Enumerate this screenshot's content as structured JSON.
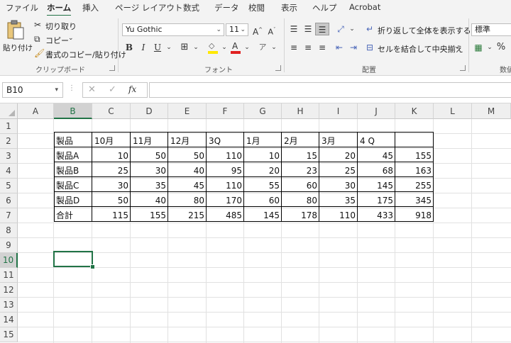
{
  "ribbon_tabs": [
    "ファイル",
    "ホーム",
    "挿入",
    "ページ レイアウト",
    "数式",
    "データ",
    "校閲",
    "表示",
    "ヘルプ",
    "Acrobat"
  ],
  "active_tab": "ホーム",
  "clipboard": {
    "paste_label": "貼り付け",
    "cut_label": "切り取り",
    "copy_label": "コピー",
    "format_painter_label": "書式のコピー/貼り付け",
    "group_label": "クリップボード"
  },
  "font": {
    "font_name": "Yu Gothic",
    "font_size": "11",
    "bold": "B",
    "italic": "I",
    "underline": "U",
    "group_label": "フォント",
    "font_color_hex": "#e02020",
    "highlight_color_hex": "#ffe800"
  },
  "alignment": {
    "wrap_text_label": "折り返して全体を表示する",
    "merge_center_label": "セルを結合して中央揃え",
    "group_label": "配置"
  },
  "number": {
    "format_value": "標準",
    "percent": "%",
    "group_label": "数値"
  },
  "formula_bar": {
    "name_box": "B10",
    "fx": "fx",
    "formula": ""
  },
  "grid": {
    "columns": [
      "A",
      "B",
      "C",
      "D",
      "E",
      "F",
      "G",
      "H",
      "I",
      "J",
      "K",
      "L",
      "M"
    ],
    "rows": [
      "1",
      "2",
      "3",
      "4",
      "5",
      "6",
      "7",
      "8",
      "9",
      "10",
      "11",
      "12",
      "13",
      "14",
      "15"
    ],
    "selected_column": "B",
    "selected_row": "10",
    "active_cell": "B10",
    "accent_color": "#217346"
  },
  "table": {
    "header": [
      "製品",
      "10月",
      "11月",
      "12月",
      "3Q",
      "1月",
      "2月",
      "3月",
      "4 Q",
      ""
    ],
    "rows": [
      [
        "製品A",
        "10",
        "50",
        "50",
        "110",
        "10",
        "15",
        "20",
        "45",
        "155"
      ],
      [
        "製品B",
        "25",
        "30",
        "40",
        "95",
        "20",
        "23",
        "25",
        "68",
        "163"
      ],
      [
        "製品C",
        "30",
        "35",
        "45",
        "110",
        "55",
        "60",
        "30",
        "145",
        "255"
      ],
      [
        "製品D",
        "50",
        "40",
        "80",
        "170",
        "60",
        "80",
        "35",
        "175",
        "345"
      ],
      [
        "合計",
        "115",
        "155",
        "215",
        "485",
        "145",
        "178",
        "110",
        "433",
        "918"
      ]
    ]
  }
}
